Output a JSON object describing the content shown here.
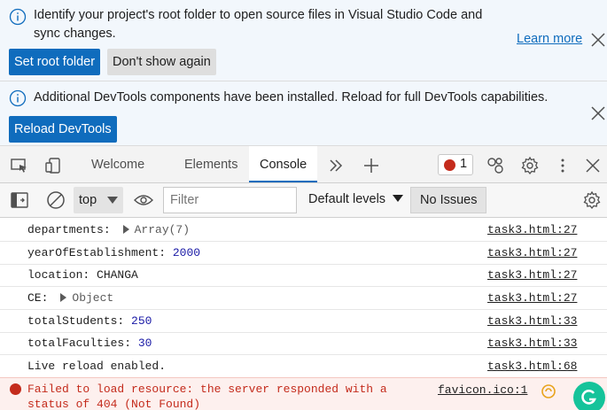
{
  "notification_root": {
    "message": "Identify your project's root folder to open source files in Visual Studio Code and sync changes.",
    "primary_button": "Set root folder",
    "secondary_button": "Don't show again",
    "learn_more": "Learn more"
  },
  "notification_reload": {
    "message": "Additional DevTools components have been installed. Reload for full DevTools capabilities.",
    "primary_button": "Reload DevTools"
  },
  "tabs": {
    "welcome": "Welcome",
    "elements": "Elements",
    "console": "Console",
    "active": "Console",
    "error_count": "1"
  },
  "toolbar": {
    "context": "top",
    "filter_placeholder": "Filter",
    "levels": "Default levels",
    "issues": "No Issues"
  },
  "console": {
    "rows": [
      {
        "key": "departments:",
        "value": "Array(7)",
        "source": "task3.html:27"
      },
      {
        "key": "yearOfEstablishment:",
        "value": "2000",
        "source": "task3.html:27"
      },
      {
        "key": "location:",
        "value": "CHANGA",
        "source": "task3.html:27"
      },
      {
        "key": "CE:",
        "value": "Object",
        "source": "task3.html:27"
      },
      {
        "key": "totalStudents:",
        "value": "250",
        "source": "task3.html:33"
      },
      {
        "key": "totalFaculties:",
        "value": "30",
        "source": "task3.html:33"
      },
      {
        "key": "Live reload enabled.",
        "value": "",
        "source": "task3.html:68"
      }
    ],
    "error": {
      "message": "Failed to load resource: the server responded with a status of 404 (Not Found)",
      "source": "favicon.ico:1"
    }
  },
  "colors": {
    "accent": "#0f6cbd",
    "error": "#c42b1c",
    "number": "#1a1aa6"
  }
}
